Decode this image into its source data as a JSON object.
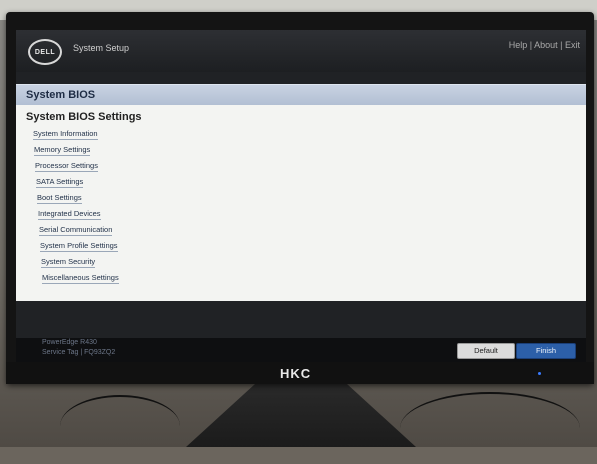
{
  "app": {
    "title": "System Setup",
    "top_links": {
      "help": "Help",
      "about": "About",
      "exit": "Exit"
    },
    "logo_text": "DELL"
  },
  "header": {
    "section": "System BIOS",
    "page_title": "System BIOS Settings"
  },
  "menu": {
    "items": [
      {
        "label": "System Information"
      },
      {
        "label": "Memory Settings"
      },
      {
        "label": "Processor Settings"
      },
      {
        "label": "SATA Settings"
      },
      {
        "label": "Boot Settings"
      },
      {
        "label": "Integrated Devices"
      },
      {
        "label": "Serial Communication"
      },
      {
        "label": "System Profile Settings"
      },
      {
        "label": "System Security"
      },
      {
        "label": "Miscellaneous Settings"
      }
    ]
  },
  "status": {
    "model": "PowerEdge R430",
    "service_tag": "Service Tag | FQ93ZQ2"
  },
  "buttons": {
    "default_label": "Default",
    "finish_label": "Finish"
  },
  "monitor": {
    "brand": "HKC"
  },
  "colors": {
    "section_bar": "#b9c6d8",
    "finish_button": "#2c5fa8",
    "page_bg": "#f3f4f2"
  }
}
